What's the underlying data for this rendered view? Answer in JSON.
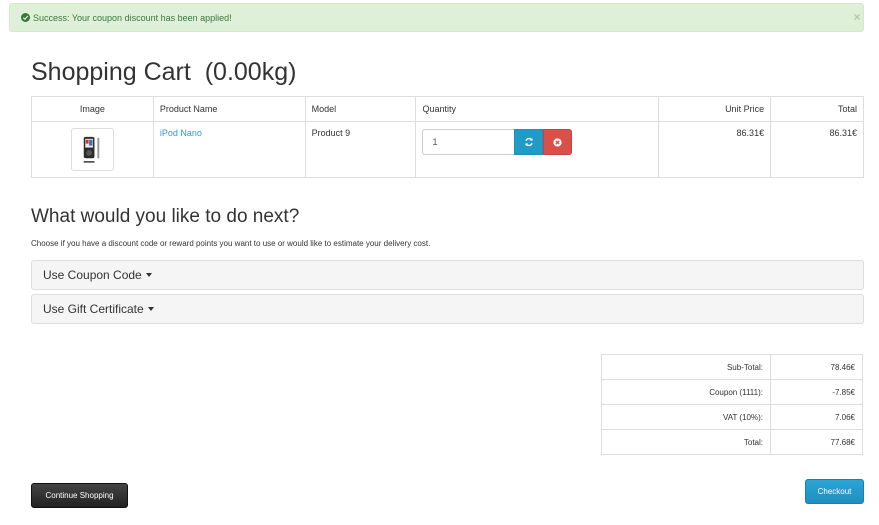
{
  "alert": {
    "message": "Success: Your coupon discount has been applied!",
    "close": "×",
    "color": "#3c763d"
  },
  "page": {
    "title": "Shopping Cart  (0.00kg)"
  },
  "cart": {
    "headers": [
      "Image",
      "Product Name",
      "Model",
      "Quantity",
      "Unit Price",
      "Total"
    ],
    "rows": [
      {
        "image_icon": "ipod-nano-thumbnail",
        "name": "iPod Nano",
        "model": "Product 9",
        "quantity": "1",
        "unit_price": "86.31€",
        "total": "86.31€"
      }
    ],
    "refresh_icon": "refresh-icon",
    "remove_icon": "remove-icon"
  },
  "next": {
    "heading": "What would you like to do next?",
    "description": "Choose if you have a discount code or reward points you want to use or would like to estimate your delivery cost.",
    "panels": [
      "Use Coupon Code",
      "Use Gift Certificate"
    ]
  },
  "totals": [
    {
      "label": "Sub-Total:",
      "value": "78.46€"
    },
    {
      "label": "Coupon (1111):",
      "value": "-7.85€"
    },
    {
      "label": "VAT (10%):",
      "value": "7.06€"
    },
    {
      "label": "Total:",
      "value": "77.68€"
    }
  ],
  "buttons": {
    "continue": "Continue Shopping",
    "checkout": "Checkout"
  },
  "colors": {
    "link": "#23a1d1",
    "primary": "#229ac8",
    "danger": "#da4f49"
  }
}
